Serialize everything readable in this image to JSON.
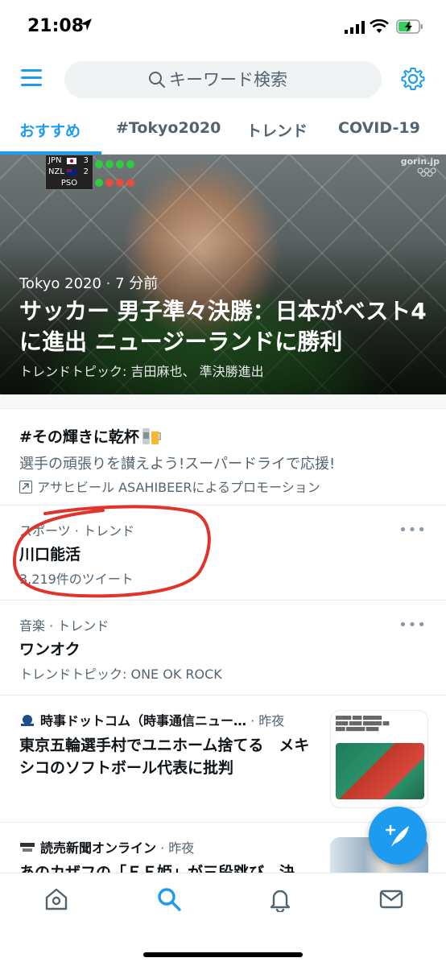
{
  "status_bar": {
    "time": "21:08"
  },
  "search": {
    "placeholder": "キーワード検索"
  },
  "tabs": [
    {
      "label": "おすすめ",
      "active": true
    },
    {
      "label": "#Tokyo2020",
      "active": false
    },
    {
      "label": "トレンド",
      "active": false
    },
    {
      "label": "COVID-19",
      "active": false
    }
  ],
  "hero": {
    "scoreboard": {
      "team1": "JPN",
      "score1": "3",
      "team2": "NZL",
      "score2": "2",
      "label": "PSO"
    },
    "watermark": "gorin.jp",
    "source": "Tokyo 2020",
    "time": "7 分前",
    "title": "サッカー 男子準々決勝：日本がベスト4に進出 ニュージーランドに勝利",
    "topic": "トレンドトピック: 吉田麻也、 準決勝進出"
  },
  "promo": {
    "title": "#その輝きに乾杯",
    "description": "選手の頑張りを讃えよう!スーパードライで応援!",
    "promoted_by": "アサヒビール ASAHIBEERによるプロモーション"
  },
  "trends": [
    {
      "category": "スポーツ · トレンド",
      "title": "川口能活",
      "meta": "3,219件のツイート",
      "more": "•••"
    },
    {
      "category": "音楽 · トレンド",
      "title": "ワンオク",
      "meta": "トレンドトピック: ONE OK ROCK",
      "more": "•••"
    }
  ],
  "news": [
    {
      "source": "時事ドットコム（時事通信ニュー…",
      "time": "· 昨夜",
      "title": "東京五輪選手村でユニホーム捨てる　メキシコのソフトボール代表に批判"
    },
    {
      "source": "読売新聞オンライン",
      "time": "· 昨夜",
      "title": "あのカザフの「ＦＦ姫」が三段跳び…決"
    }
  ],
  "colors": {
    "accent": "#1d9bf0",
    "annotation": "#e0332a",
    "secondary_text": "#536471"
  },
  "icons": [
    "hamburger-menu-icon",
    "search-icon",
    "gear-icon",
    "compose-tweet-icon",
    "home-icon",
    "explore-icon",
    "notifications-icon",
    "messages-icon"
  ]
}
